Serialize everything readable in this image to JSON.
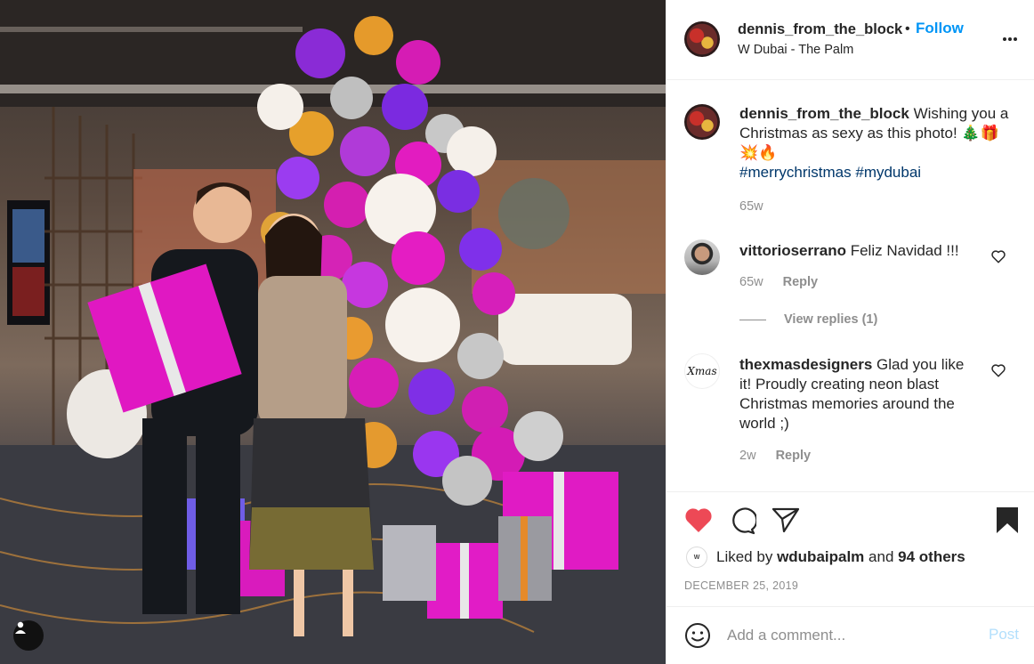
{
  "post": {
    "username": "dennis_from_the_block",
    "separator": "•",
    "follow_label": "Follow",
    "location": "W Dubai - The Palm"
  },
  "caption": {
    "username": "dennis_from_the_block",
    "text": "Wishing you a Christmas as sexy as this photo! 🎄🎁💥🔥",
    "hashtags": [
      "#merrychristmas",
      "#mydubai"
    ],
    "time": "65w"
  },
  "comments": [
    {
      "username": "vittorioserrano",
      "text": "Feliz Navidad !!!",
      "time": "65w",
      "reply_label": "Reply",
      "view_replies": "View replies (1)"
    },
    {
      "username": "thexmasdesigners",
      "text": "Glad you like it! Proudly creating neon blast Christmas memories around the world ;)",
      "time": "2w",
      "reply_label": "Reply",
      "avatar_text": "Xmas"
    }
  ],
  "likes": {
    "prefix": "Liked by",
    "user": "wdubaipalm",
    "connector": "and",
    "others": "94 others",
    "avatar_text": "W"
  },
  "date": "DECEMBER 25, 2019",
  "add_comment": {
    "placeholder": "Add a comment...",
    "post_label": "Post"
  },
  "colors": {
    "accent": "#0095f6",
    "like_red": "#ed4956",
    "post_disabled": "#b2dffc",
    "muted": "#8e8e8e"
  },
  "icons": {
    "like": "heart-filled-icon",
    "comment": "comment-bubble-icon",
    "share": "paper-plane-icon",
    "save": "bookmark-filled-icon",
    "more": "more-dots-icon",
    "emoji": "smiley-icon",
    "tag": "user-tag-icon"
  }
}
